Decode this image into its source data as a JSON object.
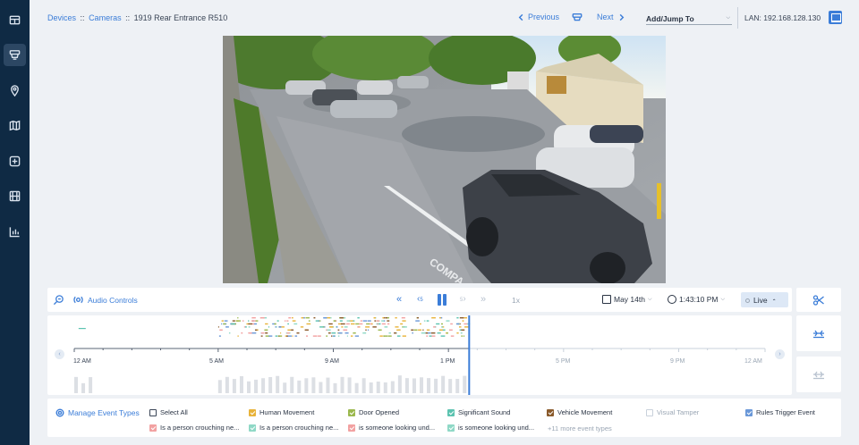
{
  "sidebar": {
    "items": [
      {
        "name": "dashboard-icon"
      },
      {
        "name": "camera-icon"
      },
      {
        "name": "location-icon"
      },
      {
        "name": "map-icon"
      },
      {
        "name": "medkit-icon"
      },
      {
        "name": "film-icon"
      },
      {
        "name": "analytics-icon"
      }
    ],
    "active_index": 1,
    "colors": {
      "bg": "#0f2a44",
      "active": "#2c4763"
    }
  },
  "header": {
    "breadcrumb": {
      "devices": "Devices",
      "sep1": "::",
      "cameras": "Cameras",
      "sep2": "::",
      "camera_name": "1919 Rear Entrance R510"
    },
    "previous_label": "Previous",
    "next_label": "Next",
    "jump_label": "Add/Jump To",
    "lan_label": "LAN: 192.168.128.130"
  },
  "controls": {
    "audio_label": "Audio Controls",
    "skip_back_label": "5",
    "skip_forward_label": "5",
    "speed_label": "1x",
    "date_label": "May 14th",
    "time_label": "1:43:10 PM",
    "live_label": "Live"
  },
  "timeline": {
    "ticks": [
      {
        "label": "12 AM",
        "hour": 0
      },
      {
        "label": "5 AM",
        "hour": 5
      },
      {
        "label": "9 AM",
        "hour": 9
      },
      {
        "label": "1 PM",
        "hour": 13
      },
      {
        "label": "5 PM",
        "hour": 17
      },
      {
        "label": "9 PM",
        "hour": 21
      },
      {
        "label": "12 AM",
        "hour": 24
      }
    ],
    "current_hour": 13.72
  },
  "filters": {
    "manage_label": "Manage Event Types",
    "row1": [
      {
        "label": "Select All",
        "checked": false,
        "color": "#ffffff",
        "muted": false
      },
      {
        "label": "Human Movement",
        "checked": true,
        "color": "#e8b33a",
        "muted": false
      },
      {
        "label": "Door Opened",
        "checked": true,
        "color": "#9bb84d",
        "muted": false
      },
      {
        "label": "Significant Sound",
        "checked": true,
        "color": "#5cc3b0",
        "muted": false
      },
      {
        "label": "Vehicle Movement",
        "checked": true,
        "color": "#8a5a2b",
        "muted": false
      },
      {
        "label": "Visual Tamper",
        "checked": false,
        "color": "#ffffff",
        "muted": true
      },
      {
        "label": "Rules Trigger Event",
        "checked": true,
        "color": "#6a98d8",
        "muted": false
      }
    ],
    "row2": [
      {
        "label": "Is a person crouching ne...",
        "checked": true,
        "color": "#f2a1a1"
      },
      {
        "label": "Is a person crouching ne...",
        "checked": true,
        "color": "#8fd8c6"
      },
      {
        "label": "is someone looking und...",
        "checked": true,
        "color": "#f2a1a1"
      },
      {
        "label": "is someone looking und...",
        "checked": true,
        "color": "#8fd8c6"
      }
    ],
    "more_label": "+11 more event types"
  },
  "colors": {
    "accent": "#3b7dd8"
  }
}
